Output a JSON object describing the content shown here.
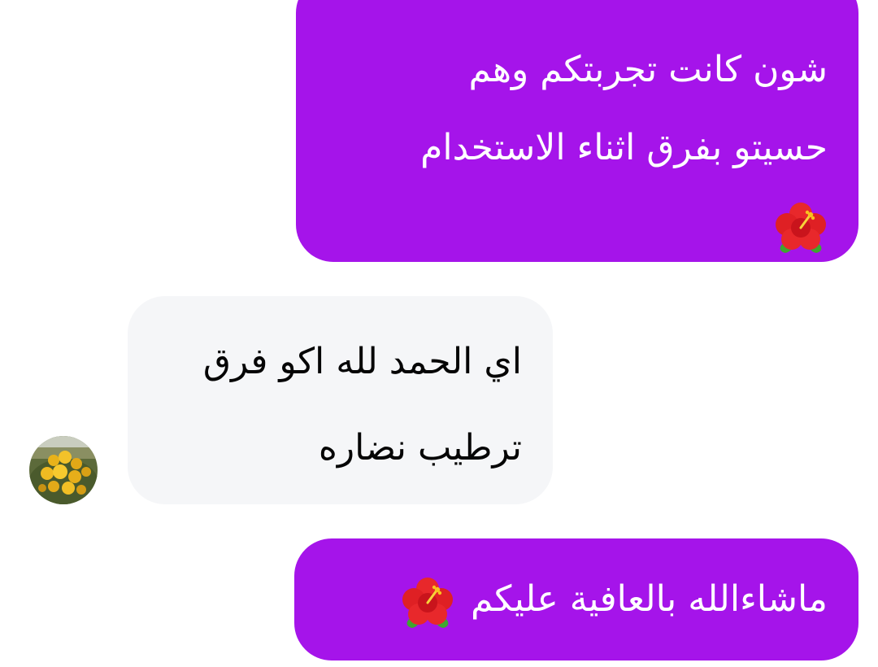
{
  "conversation": {
    "messages": [
      {
        "direction": "outgoing",
        "lines": [
          "شون كانت تجربتكم وهم",
          "حسيتو بفرق اثناء الاستخدام"
        ],
        "emoji": "hibiscus-icon"
      },
      {
        "direction": "incoming",
        "lines": [
          "اي الحمد لله اكو فرق",
          "ترطيب نضاره"
        ]
      },
      {
        "direction": "outgoing",
        "lines": [
          "ماشاءالله  بالعافية عليكم"
        ],
        "emoji": "hibiscus-icon"
      }
    ],
    "contact_avatar": "flower-photo-avatar"
  },
  "colors": {
    "outgoing_bubble": "#a514ea",
    "incoming_bubble": "#f5f6f8",
    "outgoing_text": "#ffffff",
    "incoming_text": "#050505"
  }
}
